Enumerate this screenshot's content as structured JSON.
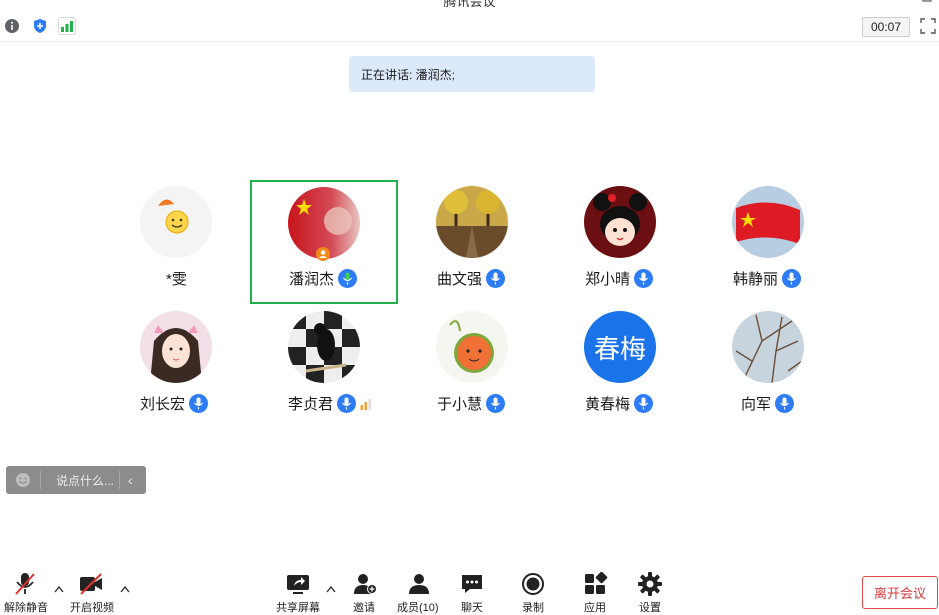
{
  "window": {
    "title": "腾讯会议"
  },
  "topbar": {
    "timer": "00:07"
  },
  "speaking": {
    "text": "正在讲话: 潘润杰;"
  },
  "participants": [
    {
      "name": "*雯",
      "mic": false,
      "avatar_text": ""
    },
    {
      "name": "潘润杰",
      "mic": true,
      "active": true,
      "avatar_text": ""
    },
    {
      "name": "曲文强",
      "mic": true,
      "avatar_text": ""
    },
    {
      "name": "郑小晴",
      "mic": true,
      "avatar_text": ""
    },
    {
      "name": "韩静丽",
      "mic": true,
      "avatar_text": ""
    },
    {
      "name": "刘长宏",
      "mic": true,
      "avatar_text": ""
    },
    {
      "name": "李贞君",
      "mic": true,
      "avatar_text": ""
    },
    {
      "name": "于小慧",
      "mic": true,
      "avatar_text": ""
    },
    {
      "name": "黄春梅",
      "mic": true,
      "avatar_text": "春梅"
    },
    {
      "name": "向军",
      "mic": true,
      "avatar_text": ""
    }
  ],
  "chat": {
    "placeholder": "说点什么...",
    "collapse_glyph": "‹"
  },
  "toolbar": {
    "unmute": "解除静音",
    "video": "开启视频",
    "share": "共享屏幕",
    "invite": "邀请",
    "members": "成员(10)",
    "chat": "聊天",
    "record": "录制",
    "apps": "应用",
    "settings": "设置",
    "leave": "离开会议"
  },
  "colors": {
    "accent": "#2d7cf6",
    "speaking_bg": "#dce9fb",
    "active_border": "#22b14c",
    "leave": "#d63b3b"
  }
}
